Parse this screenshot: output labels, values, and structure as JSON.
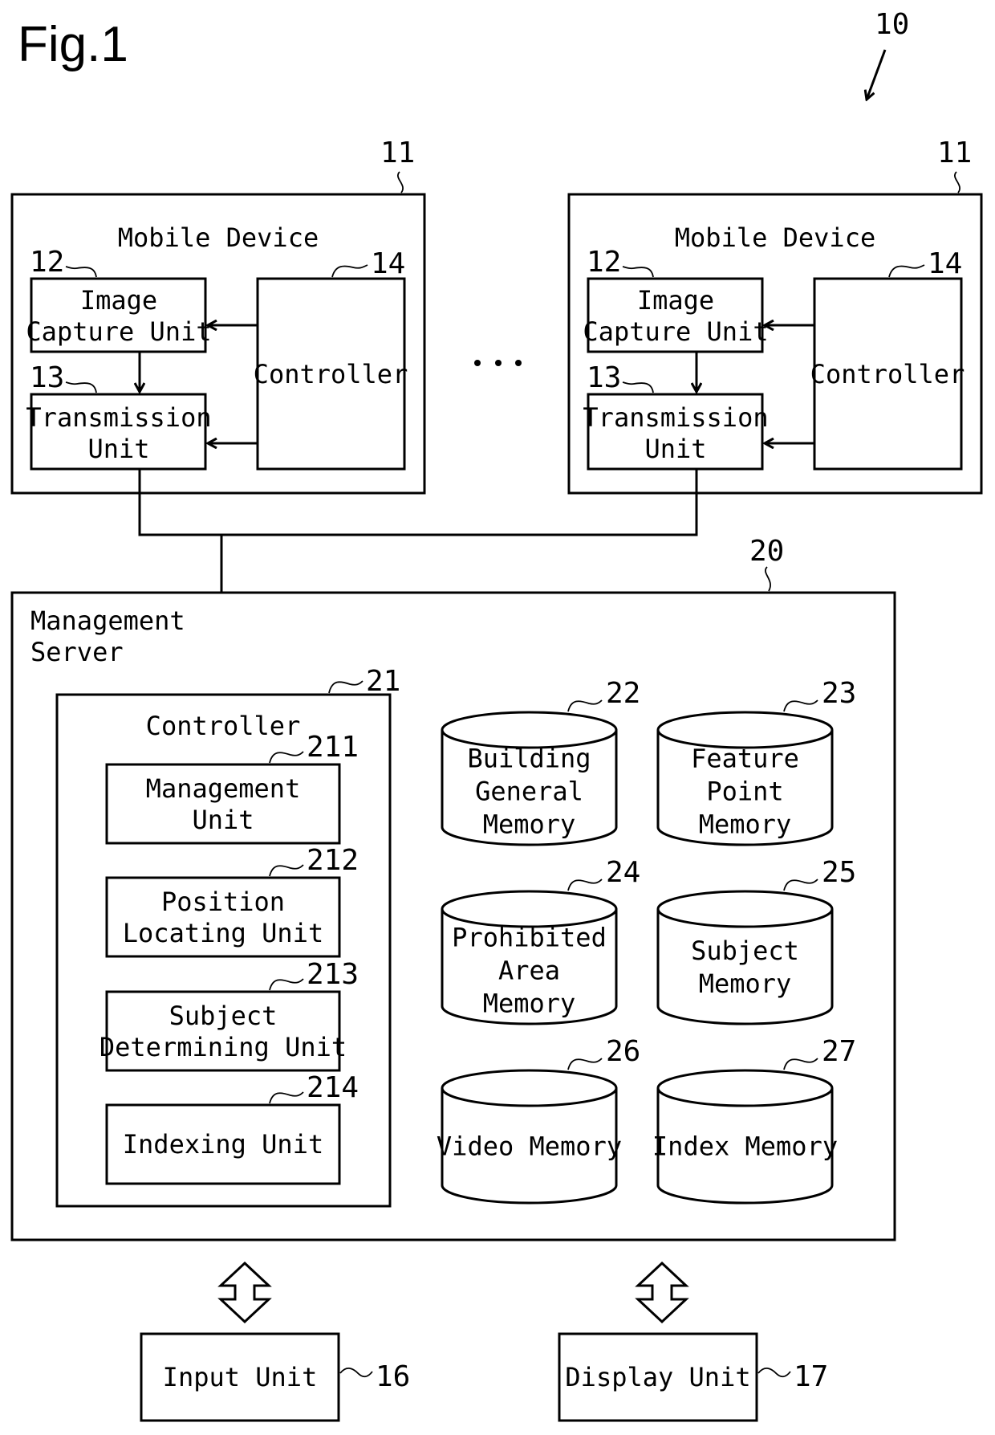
{
  "figure": {
    "title": "Fig.1",
    "system_ref": "10"
  },
  "mobile_devices": [
    {
      "ref": "11",
      "title": "Mobile Device",
      "image_capture": {
        "ref": "12",
        "lines": [
          "Image",
          "Capture Unit"
        ]
      },
      "transmission": {
        "ref": "13",
        "lines": [
          "Transmission",
          "Unit"
        ]
      },
      "controller": {
        "ref": "14",
        "label": "Controller"
      }
    },
    {
      "ref": "11",
      "title": "Mobile Device",
      "image_capture": {
        "ref": "12",
        "lines": [
          "Image",
          "Capture Unit"
        ]
      },
      "transmission": {
        "ref": "13",
        "lines": [
          "Transmission",
          "Unit"
        ]
      },
      "controller": {
        "ref": "14",
        "label": "Controller"
      }
    }
  ],
  "ellipsis": "…",
  "server": {
    "ref": "20",
    "title_lines": [
      "Management",
      "Server"
    ],
    "controller": {
      "ref": "21",
      "title": "Controller",
      "units": [
        {
          "ref": "211",
          "lines": [
            "Management",
            "Unit"
          ]
        },
        {
          "ref": "212",
          "lines": [
            "Position",
            "Locating Unit"
          ]
        },
        {
          "ref": "213",
          "lines": [
            "Subject",
            "Determining Unit"
          ]
        },
        {
          "ref": "214",
          "lines": [
            "Indexing Unit"
          ]
        }
      ]
    },
    "memories": [
      {
        "ref": "22",
        "lines": [
          "Building",
          "General",
          "Memory"
        ]
      },
      {
        "ref": "23",
        "lines": [
          "Feature",
          "Point",
          "Memory"
        ]
      },
      {
        "ref": "24",
        "lines": [
          "Prohibited",
          "Area",
          "Memory"
        ]
      },
      {
        "ref": "25",
        "lines": [
          "Subject",
          "Memory"
        ]
      },
      {
        "ref": "26",
        "lines": [
          "Video Memory"
        ]
      },
      {
        "ref": "27",
        "lines": [
          "Index Memory"
        ]
      }
    ]
  },
  "peripherals": [
    {
      "ref": "16",
      "label": "Input Unit"
    },
    {
      "ref": "17",
      "label": "Display Unit"
    }
  ]
}
